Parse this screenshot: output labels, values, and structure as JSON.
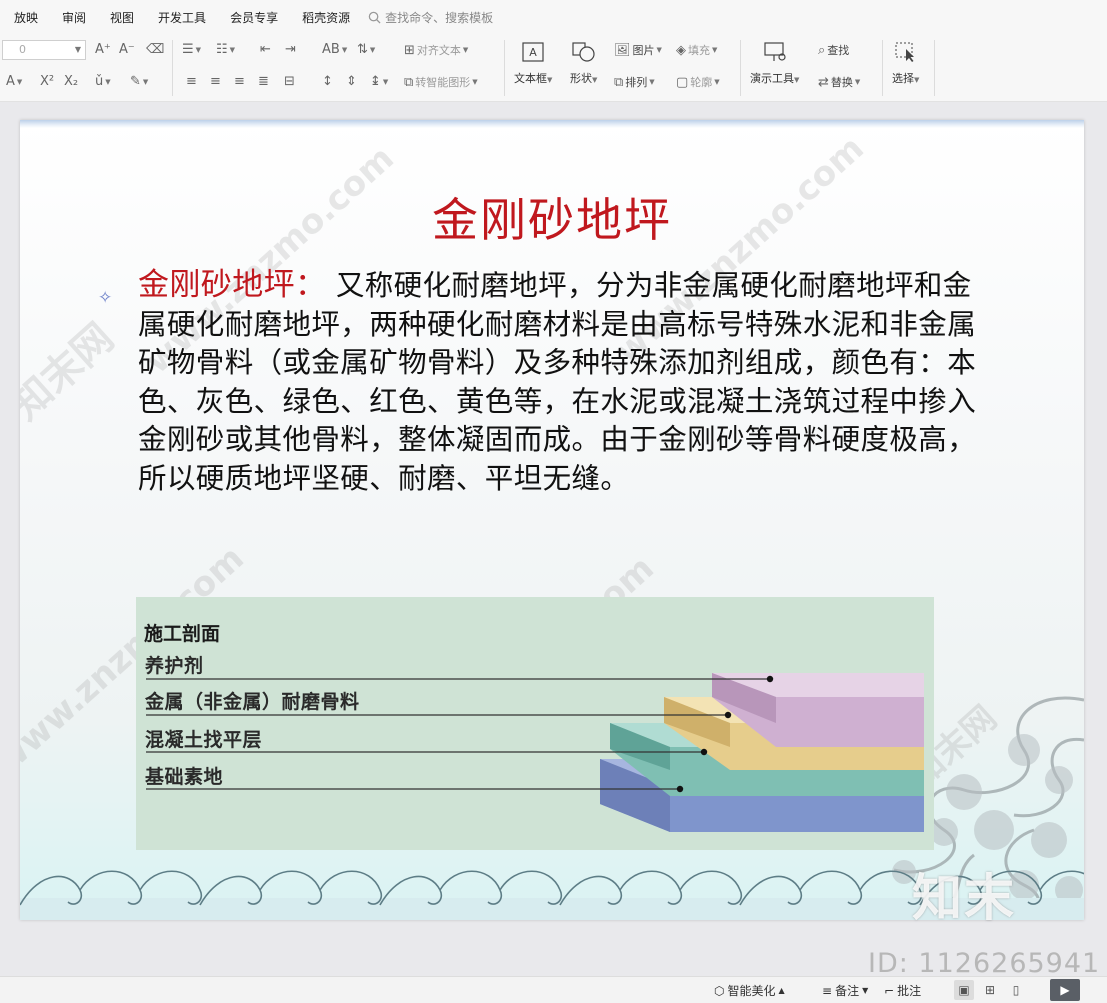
{
  "menu": {
    "items": [
      "放映",
      "审阅",
      "视图",
      "开发工具",
      "会员专享",
      "稻壳资源"
    ],
    "search_placeholder": "查找命令、搜索模板"
  },
  "ribbon": {
    "font_size": "0",
    "align_text": "对齐文本",
    "smart_shape": "转智能图形",
    "textbox": "文本框",
    "shape": "形状",
    "picture": "图片",
    "fill": "填充",
    "arrange": "排列",
    "outline": "轮廓",
    "present_tools": "演示工具",
    "find": "查找",
    "replace": "替换",
    "select": "选择"
  },
  "slide": {
    "title": "金刚砂地坪",
    "term": "金刚砂地坪：",
    "body": "又称硬化耐磨地坪，分为非金属硬化耐磨地坪和金属硬化耐磨地坪，两种硬化耐磨材料是由高标号特殊水泥和非金属矿物骨料（或金属矿物骨料）及多种特殊添加剂组成，颜色有：本色、灰色、绿色、红色、黄色等，在水泥或混凝土浇筑过程中掺入金刚砂或其他骨料，整体凝固而成。由于金刚砂等骨料硬度极高，所以硬质地坪坚硬、耐磨、平坦无缝。",
    "diagram": {
      "title": "施工剖面",
      "layers": [
        "养护剂",
        "金属（非金属）耐磨骨料",
        "混凝土找平层",
        "基础素地"
      ],
      "colors": [
        "#d8bfd8",
        "#ebd49c",
        "#8fc7be",
        "#8aa0d4"
      ]
    }
  },
  "watermark": {
    "site": "www.znzmo.com",
    "brand": "知末网",
    "logo": "知末",
    "id": "ID: 1126265941"
  },
  "statusbar": {
    "beautify": "智能美化",
    "notes": "备注",
    "comments": "批注"
  }
}
